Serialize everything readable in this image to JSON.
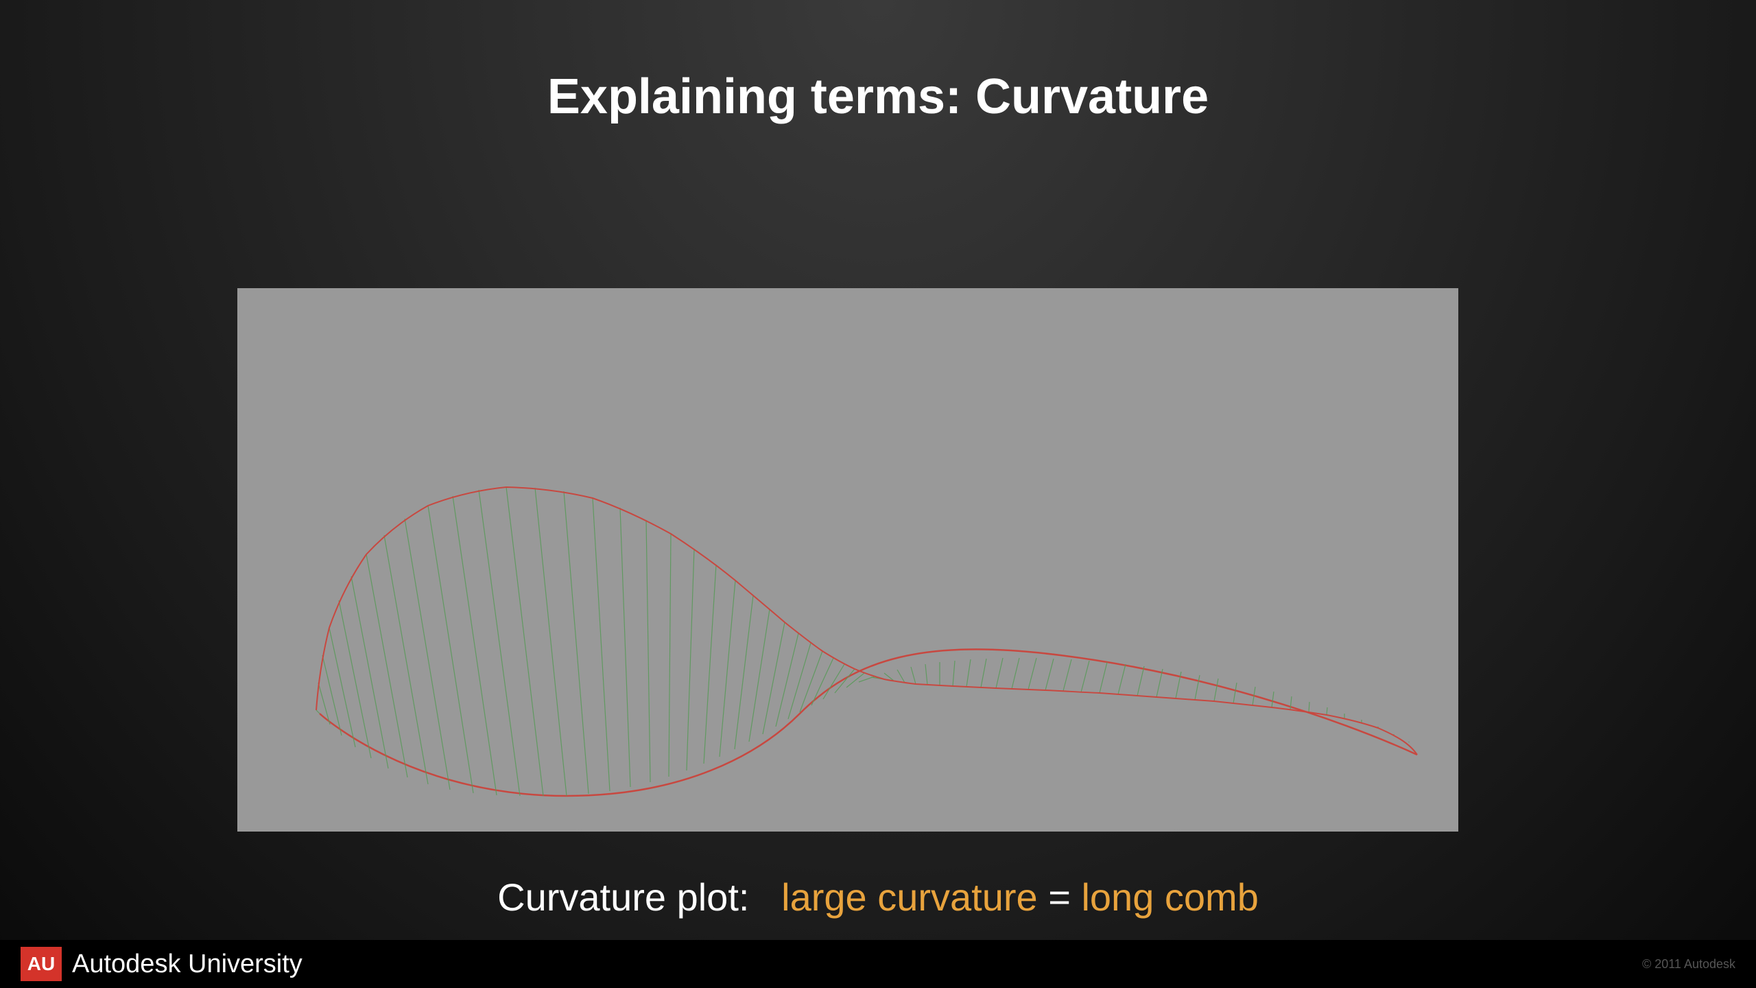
{
  "title": "Explaining terms: Curvature",
  "subtitle": {
    "label": "Curvature plot:",
    "part1": "large curvature",
    "equals": "=",
    "part2": "long comb"
  },
  "footer": {
    "logo": "AU",
    "brand": "Autodesk University",
    "copyright": "© 2011 Autodesk"
  },
  "diagram": {
    "description": "Curvature comb plot showing a spline curve with perpendicular comb lines indicating curvature magnitude. Longer combs on left bulge indicate higher curvature; combs shorten toward the tapering right end.",
    "curve_color": "#c84840",
    "comb_color": "#5a9a5a",
    "envelope_color": "#c84840"
  }
}
